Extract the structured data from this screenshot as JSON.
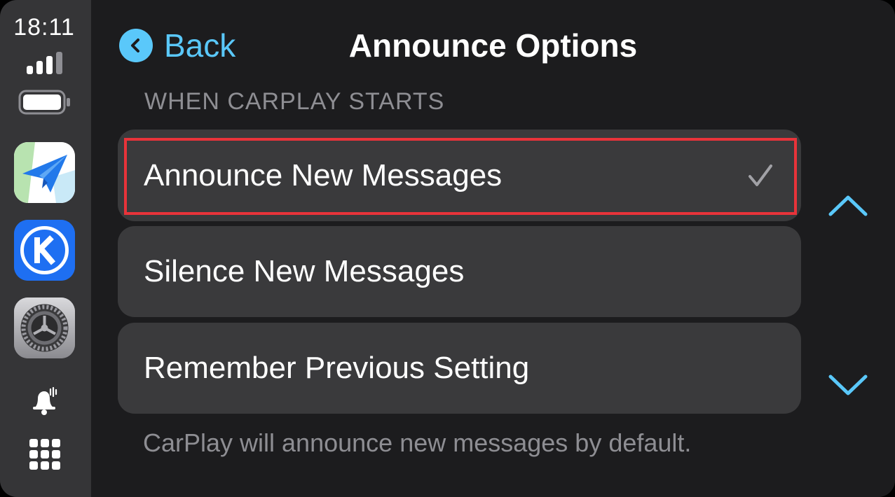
{
  "status": {
    "time": "18:11"
  },
  "sidebar": {
    "apps": [
      {
        "name": "navigation-app",
        "icon": "paper-plane-map-icon"
      },
      {
        "name": "k-app",
        "icon": "k-letter-icon"
      },
      {
        "name": "settings-app",
        "icon": "gear-icon"
      }
    ],
    "announce_icon": "bell-with-waves-icon",
    "home_icon": "app-grid-icon"
  },
  "header": {
    "back_label": "Back",
    "title": "Announce Options"
  },
  "section": {
    "header": "WHEN CARPLAY STARTS",
    "options": [
      {
        "label": "Announce New Messages",
        "selected": true
      },
      {
        "label": "Silence New Messages",
        "selected": false
      },
      {
        "label": "Remember Previous Setting",
        "selected": false
      }
    ],
    "footer": "CarPlay will announce new messages by default."
  },
  "colors": {
    "accent": "#5ac8fa",
    "highlight": "#e8333a",
    "row_background": "#3a3a3c",
    "sidebar_background": "#353537",
    "background": "#1c1c1e"
  }
}
